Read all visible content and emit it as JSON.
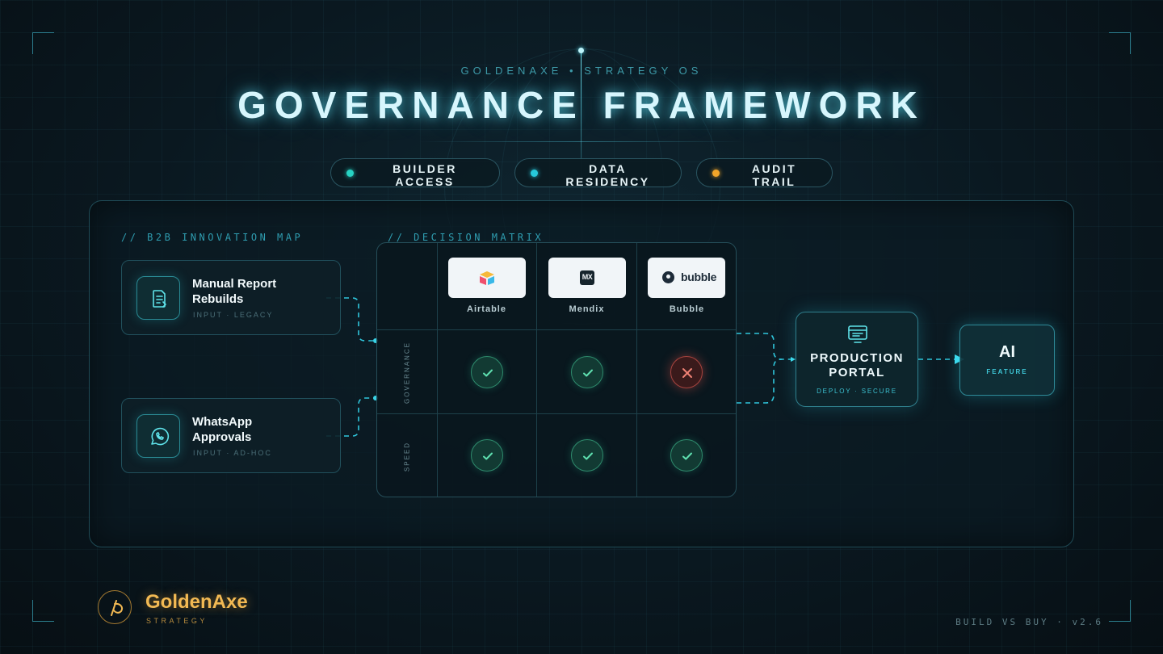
{
  "header": {
    "kicker": "GOLDENAXE • STRATEGY OS",
    "title": "GOVERNANCE FRAMEWORK"
  },
  "pills": [
    {
      "label": "BUILDER\nACCESS",
      "dot_color": "#27d3c3"
    },
    {
      "label": "DATA\nRESIDENCY",
      "dot_color": "#27c9dc"
    },
    {
      "label": "AUDIT\nTRAIL",
      "dot_color": "#f2a62a"
    }
  ],
  "map": {
    "heading": "// B2B INNOVATION MAP",
    "cards": [
      {
        "title": "Manual Report\nRebuilds",
        "subtitle": "INPUT · LEGACY",
        "icon": "document-icon"
      },
      {
        "title": "WhatsApp\nApprovals",
        "subtitle": "INPUT · AD-HOC",
        "icon": "whatsapp-icon"
      }
    ]
  },
  "matrix": {
    "heading": "// DECISION MATRIX",
    "vendors": [
      {
        "name": "Airtable",
        "logo_text": ""
      },
      {
        "name": "Mendix",
        "logo_text": "MX"
      },
      {
        "name": "Bubble",
        "logo_text": "bubble"
      }
    ],
    "rows": [
      {
        "label": "GOVERNANCE",
        "results": [
          "pass",
          "pass",
          "fail"
        ]
      },
      {
        "label": "SPEED",
        "results": [
          "pass",
          "pass",
          "pass"
        ]
      }
    ]
  },
  "portal": {
    "title": "PRODUCTION\nPORTAL",
    "subtitle": "DEPLOY · SECURE"
  },
  "ai": {
    "title": "AI",
    "subtitle": "FEATURE"
  },
  "brand": {
    "name": "GoldenAxe",
    "tagline": "STRATEGY"
  },
  "footer": {
    "version": "BUILD VS BUY · v2.6"
  },
  "colors": {
    "accent": "#2fd4e6",
    "pass": "#4fd6a8",
    "fail": "#e86a5e",
    "brand": "#f2b953"
  }
}
